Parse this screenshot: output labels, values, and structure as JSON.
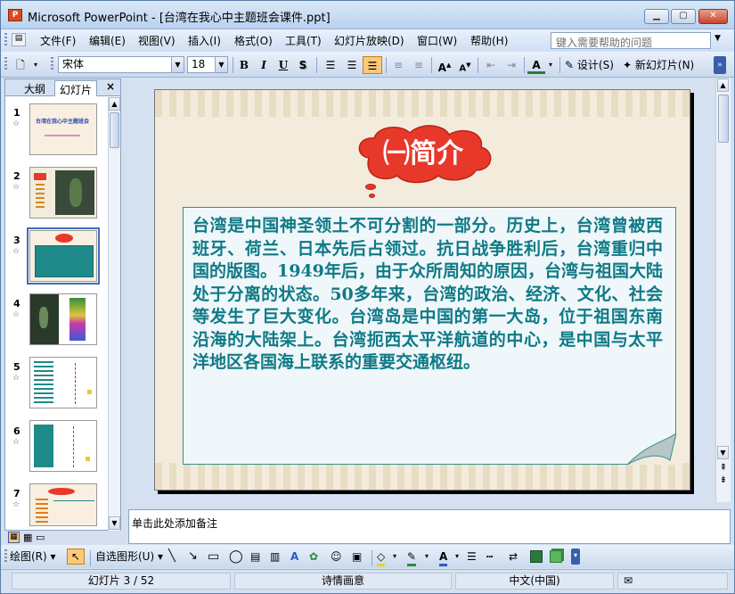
{
  "window": {
    "title": "Microsoft PowerPoint - [台湾在我心中主题班会课件.ppt]",
    "app_icon": "P"
  },
  "menu": {
    "items": [
      "文件(F)",
      "编辑(E)",
      "视图(V)",
      "插入(I)",
      "格式(O)",
      "工具(T)",
      "幻灯片放映(D)",
      "窗口(W)",
      "帮助(H)"
    ],
    "help_placeholder": "键入需要帮助的问题"
  },
  "toolbar": {
    "font_name": "宋体",
    "font_size": "18",
    "bold": "B",
    "italic": "I",
    "underline": "U",
    "shadow": "S",
    "design_label": "设计(S)",
    "new_slide_label": "新幻灯片(N)"
  },
  "left_panel": {
    "tabs": [
      "大纲",
      "幻灯片"
    ],
    "close": "×",
    "thumbnails": [
      {
        "num": "1"
      },
      {
        "num": "2"
      },
      {
        "num": "3",
        "selected": true
      },
      {
        "num": "4"
      },
      {
        "num": "5"
      },
      {
        "num": "6"
      },
      {
        "num": "7"
      }
    ],
    "thumb1_title": "台湾在我心中主题班会"
  },
  "slide": {
    "title": "㈠简介",
    "body": "台湾是中国神圣领土不可分割的一部分。历史上，台湾曾被西班牙、荷兰、日本先后占领过。抗日战争胜利后，台湾重归中国的版图。1949年后，由于众所周知的原因，台湾与祖国大陆处于分离的状态。50多年来，台湾的政治、经济、文化、社会等发生了巨大变化。台湾岛是中国的第一大岛，位于祖国东南沿海的大陆架上。台湾扼西太平洋航道的中心，是中国与太平洋地区各国海上联系的重要交通枢纽。",
    "bubble_color": "#e8382a",
    "text_color": "#0f7a86"
  },
  "notes": {
    "placeholder": "单击此处添加备注"
  },
  "drawing": {
    "draw_label": "绘图(R)",
    "autoshapes_label": "自选图形(U)"
  },
  "status": {
    "slide_info": "幻灯片 3 / 52",
    "design": "诗情画意",
    "language": "中文(中国)"
  }
}
